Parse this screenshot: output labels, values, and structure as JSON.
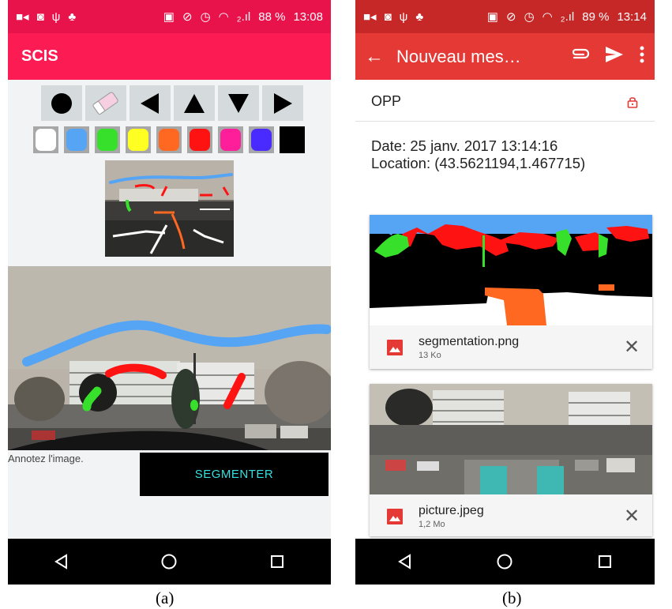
{
  "colors": {
    "accent_left": "#fc1b52",
    "accent_right": "#e53935",
    "segment_button_text": "#36e0e0",
    "file_icon": "#e53935"
  },
  "panel_a": {
    "status": {
      "left_icons": [
        "video-icon",
        "camera-icon",
        "usb-icon",
        "android-icon"
      ],
      "right_icons": [
        "cast-icon",
        "do-not-disturb-icon",
        "alarm-icon",
        "wifi-icon"
      ],
      "signal": "₂.ıl",
      "battery_percent": "88 %",
      "time": "13:08"
    },
    "title": "SCIS",
    "tools": [
      "brush-icon",
      "eraser-icon",
      "arrow-left-icon",
      "arrow-up-icon",
      "arrow-down-icon",
      "arrow-right-icon"
    ],
    "palette": [
      "#ffffff",
      "#56a5f4",
      "#36e02b",
      "#ffff22",
      "#ff6820",
      "#ff1212",
      "#ff1e9a",
      "#4a2bff",
      "#000000"
    ],
    "hint": "Annotez l'image.",
    "segment_button": "SEGMENTER",
    "nav": [
      "back-nav-icon",
      "home-nav-icon",
      "recent-apps-icon"
    ],
    "caption": "(a)"
  },
  "panel_b": {
    "status": {
      "left_icons": [
        "video-icon",
        "camera-icon",
        "usb-icon",
        "android-icon"
      ],
      "right_icons": [
        "cast-icon",
        "do-not-disturb-icon",
        "alarm-icon",
        "wifi-icon"
      ],
      "signal": "₂.ıl",
      "battery_percent": "89 %",
      "time": "13:14"
    },
    "title": "Nouveau mes…",
    "actions": [
      "attachment-icon",
      "send-icon",
      "more-icon"
    ],
    "recipient": "OPP",
    "body": {
      "date": "Date: 25 janv. 2017 13:14:16",
      "location": "Location: (43.5621194,1.467715)"
    },
    "attachments": [
      {
        "name": "segmentation.png",
        "size": "13 Ko"
      },
      {
        "name": "picture.jpeg",
        "size": "1,2 Mo"
      }
    ],
    "nav": [
      "back-nav-icon",
      "home-nav-icon",
      "recent-apps-icon"
    ],
    "caption": "(b)"
  }
}
